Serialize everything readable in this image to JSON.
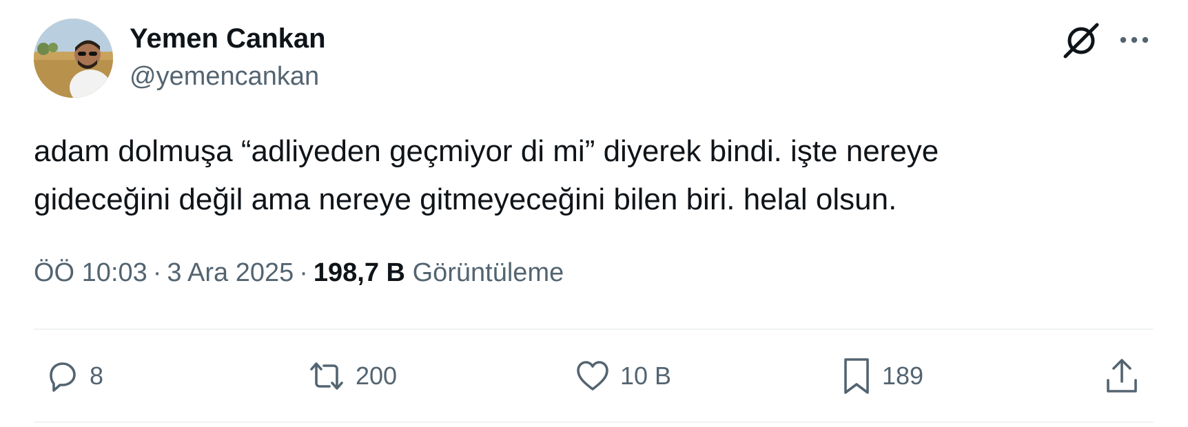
{
  "author": {
    "display_name": "Yemen Cankan",
    "handle": "@yemencankan",
    "avatar_icon": "profile-photo"
  },
  "header_icons": {
    "grok": "grok-icon",
    "more": "more-icon"
  },
  "tweet": {
    "text_lines": [
      "adam dolmuşa “adliyeden geçmiyor di mi” diyerek bindi. işte nereye",
      "gideceğini değil ama nereye gitmeyeceğini bilen biri. helal olsun."
    ]
  },
  "meta": {
    "time": "ÖÖ 10:03",
    "separator": "·",
    "date": "3 Ara 2025",
    "views_count": "198,7 B",
    "views_label": "Görüntüleme"
  },
  "actions": {
    "reply": {
      "icon": "reply-icon",
      "count": "8"
    },
    "retweet": {
      "icon": "retweet-icon",
      "count": "200"
    },
    "like": {
      "icon": "heart-icon",
      "count": "10 B"
    },
    "bookmark": {
      "icon": "bookmark-icon",
      "count": "189"
    },
    "share": {
      "icon": "share-icon"
    }
  },
  "colors": {
    "text_primary": "#0f1419",
    "text_secondary": "#536471",
    "divider": "#eff3f4"
  }
}
